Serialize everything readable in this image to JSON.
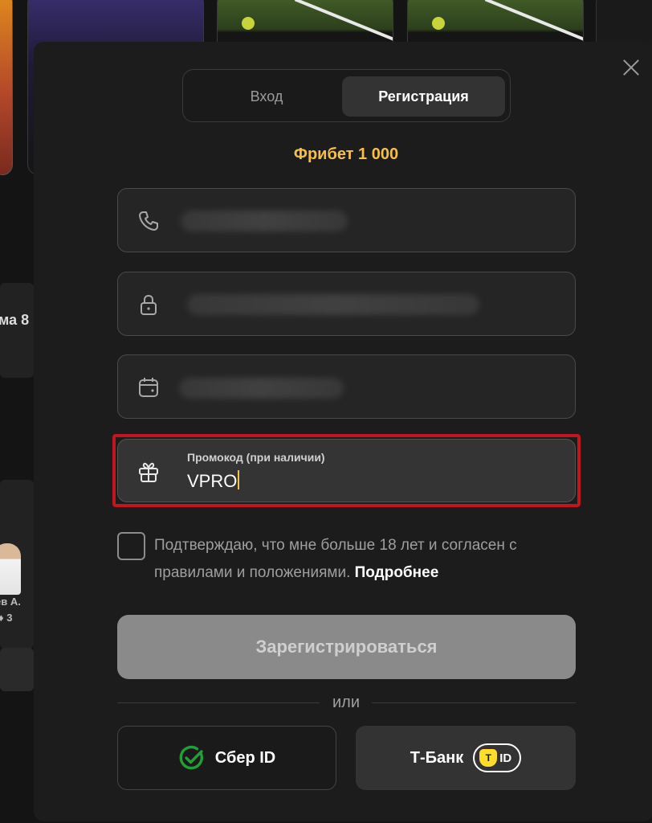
{
  "background": {
    "peek_text": "ма 8",
    "player_name": "ев А.",
    "player_score": "♦ 3"
  },
  "tabs": {
    "login": "Вход",
    "register": "Регистрация",
    "active": "register"
  },
  "promo_banner": "Фрибет 1 000",
  "fields": {
    "phone": {
      "icon": "phone-icon",
      "value_hidden": true
    },
    "password": {
      "icon": "lock-icon",
      "value_hidden": true
    },
    "birthdate": {
      "icon": "calendar-icon",
      "value_hidden": true
    },
    "promo": {
      "icon": "gift-icon",
      "label": "Промокод (при наличии)",
      "value": "VPRO"
    }
  },
  "agreement": {
    "checked": false,
    "text": "Подтверждаю, что мне больше 18 лет и согласен с правилами и положениями.",
    "link": "Подробнее"
  },
  "submit_label": "Зарегистрироваться",
  "divider_text": "или",
  "social": {
    "sber_label": "Сбер ID",
    "tbank_label": "Т-Банк",
    "tbank_badge_text": "ID",
    "tbank_shield_letter": "T"
  },
  "colors": {
    "accent": "#f5c04a",
    "highlight": "#c4151c",
    "sber_green": "#21a038",
    "tbank_yellow": "#ffdd2d"
  }
}
